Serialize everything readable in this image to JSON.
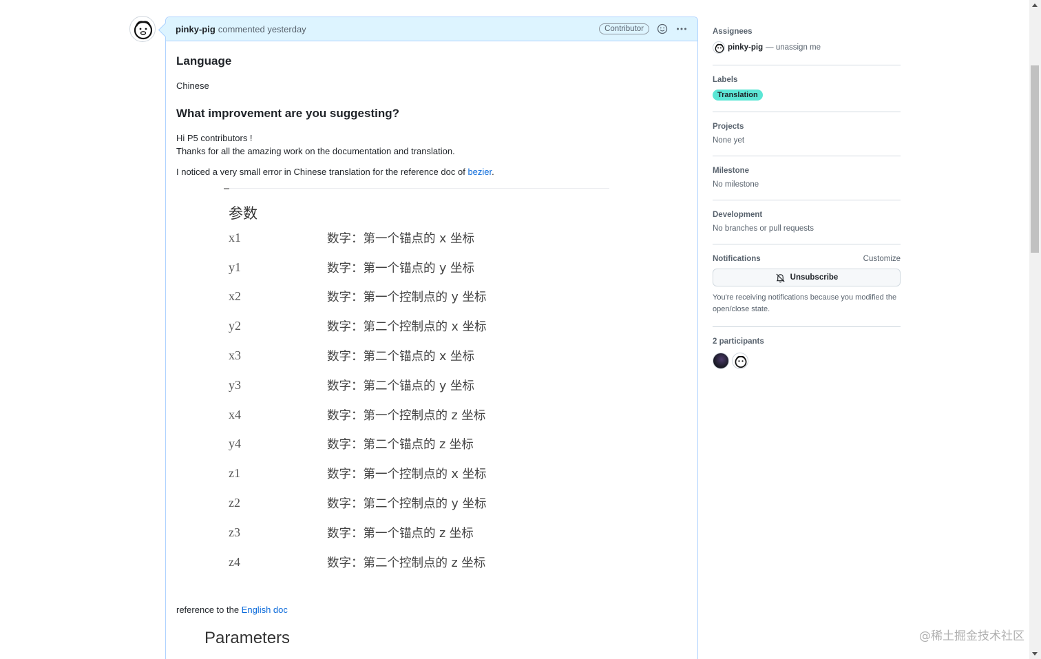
{
  "comment": {
    "author": "pinky-pig",
    "action_text": "commented yesterday",
    "role_badge": "Contributor",
    "heading_language": "Language",
    "language_value": "Chinese",
    "heading_improvement": "What improvement are you suggesting?",
    "greeting": "Hi P5 contributors !",
    "thanks": "Thanks for all the amazing work on the documentation and translation.",
    "notice_prefix": "I noticed a very small error in Chinese translation for the reference doc of ",
    "notice_link": "bezier",
    "notice_suffix": ".",
    "image_title": "参数",
    "params": [
      {
        "name": "x1",
        "desc": "数字：第一个锚点的 x 坐标"
      },
      {
        "name": "y1",
        "desc": "数字：第一个锚点的 y 坐标"
      },
      {
        "name": "x2",
        "desc": "数字：第一个控制点的 y 坐标"
      },
      {
        "name": "y2",
        "desc": "数字：第二个控制点的 x 坐标"
      },
      {
        "name": "x3",
        "desc": "数字：第二个锚点的 x 坐标"
      },
      {
        "name": "y3",
        "desc": "数字：第二个锚点的 y 坐标"
      },
      {
        "name": "x4",
        "desc": "数字：第一个控制点的 z 坐标"
      },
      {
        "name": "y4",
        "desc": "数字：第二个锚点的 z 坐标"
      },
      {
        "name": "z1",
        "desc": "数字：第一个控制点的 x 坐标"
      },
      {
        "name": "z2",
        "desc": "数字：第二个控制点的 y 坐标"
      },
      {
        "name": "z3",
        "desc": "数字：第一个锚点的 z 坐标"
      },
      {
        "name": "z4",
        "desc": "数字：第二个控制点的 z 坐标"
      }
    ],
    "reference_prefix": "reference to the ",
    "reference_link": "English doc",
    "english_title": "Parameters"
  },
  "sidebar": {
    "assignees": {
      "heading": "Assignees",
      "name": "pinky-pig",
      "unassign": "— unassign me"
    },
    "labels": {
      "heading": "Labels",
      "label": "Translation",
      "label_color": "#5ce6d5"
    },
    "projects": {
      "heading": "Projects",
      "value": "None yet"
    },
    "milestone": {
      "heading": "Milestone",
      "value": "No milestone"
    },
    "development": {
      "heading": "Development",
      "value": "No branches or pull requests"
    },
    "notifications": {
      "heading": "Notifications",
      "customize": "Customize",
      "button": "Unsubscribe",
      "note": "You're receiving notifications because you modified the open/close state."
    },
    "participants": {
      "heading": "2 participants"
    }
  },
  "watermark": "@稀土掘金技术社区",
  "colors": {
    "header_bg": "#ddf4ff",
    "header_border": "#afd3ff",
    "link": "#0969da"
  }
}
